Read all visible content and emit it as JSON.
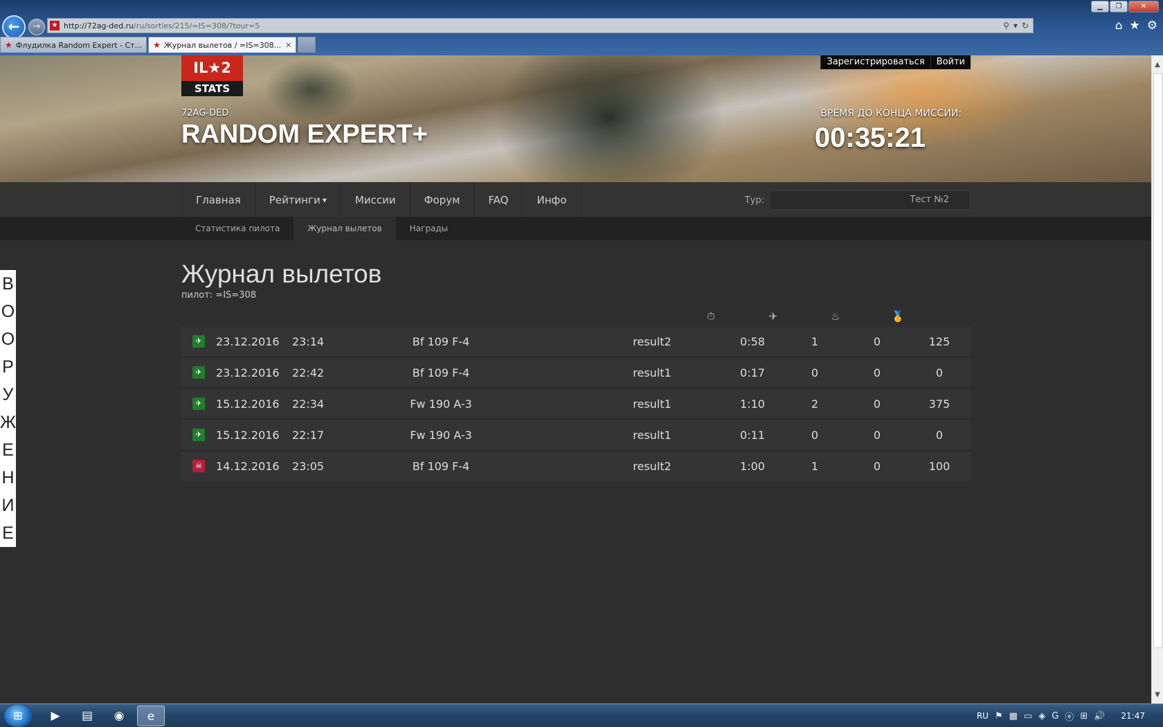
{
  "browser": {
    "url_host": "http://72ag-ded.ru",
    "url_path": "/ru/sorties/215/=IS=308/?tour=5",
    "tabs": [
      {
        "label": "Флудилка Random Expert - Ст..."
      },
      {
        "label": "Журнал вылетов / =IS=308..."
      }
    ],
    "window_controls": {
      "minimize": "▁",
      "restore": "❐",
      "close": "✕"
    }
  },
  "header": {
    "logo_top": "IL★2",
    "logo_bottom": "STATS",
    "server_name": "72AG-DED",
    "site_title": "RANDOM EXPERT+",
    "register": "Зарегистрироваться",
    "login": "Войти",
    "timer_label": "ВРЕМЯ ДО КОНЦА МИССИИ:",
    "timer_value": "00:35:21"
  },
  "nav": {
    "items": [
      "Главная",
      "Рейтинги",
      "Миссии",
      "Форум",
      "FAQ",
      "Инфо"
    ],
    "tour_label": "Тур:",
    "tour_value": "Тест №2"
  },
  "subnav": {
    "items": [
      "Статистика пилота",
      "Журнал вылетов",
      "Награды"
    ],
    "active": "Журнал вылетов"
  },
  "side_widget": {
    "letters": [
      "В",
      "О",
      "О",
      "Р",
      "У",
      "Ж",
      "Е",
      "Н",
      "И",
      "Е"
    ]
  },
  "content": {
    "title": "Журнал вылетов",
    "pilot_line": "пилот: =IS=308",
    "column_icons": [
      "stopwatch-icon",
      "plane-icon",
      "fire-icon",
      "medal-icon"
    ],
    "rows": [
      {
        "status": "landed",
        "date": "23.12.2016",
        "time": "23:14",
        "aircraft": "Bf 109 F-4",
        "result": "result2",
        "flight_time": "0:58",
        "air_kills": "1",
        "ground_kills": "0",
        "score": "125"
      },
      {
        "status": "landed",
        "date": "23.12.2016",
        "time": "22:42",
        "aircraft": "Bf 109 F-4",
        "result": "result1",
        "flight_time": "0:17",
        "air_kills": "0",
        "ground_kills": "0",
        "score": "0"
      },
      {
        "status": "landed",
        "date": "15.12.2016",
        "time": "22:34",
        "aircraft": "Fw 190 A-3",
        "result": "result1",
        "flight_time": "1:10",
        "air_kills": "2",
        "ground_kills": "0",
        "score": "375"
      },
      {
        "status": "landed",
        "date": "15.12.2016",
        "time": "22:17",
        "aircraft": "Fw 190 A-3",
        "result": "result1",
        "flight_time": "0:11",
        "air_kills": "0",
        "ground_kills": "0",
        "score": "0"
      },
      {
        "status": "killed",
        "date": "14.12.2016",
        "time": "23:05",
        "aircraft": "Bf 109 F-4",
        "result": "result2",
        "flight_time": "1:00",
        "air_kills": "1",
        "ground_kills": "0",
        "score": "100"
      }
    ]
  },
  "taskbar": {
    "language": "RU",
    "clock": "21:47"
  },
  "colors": {
    "logo_red": "#c9261c",
    "landed_green": "#1f7d2b",
    "killed_red": "#b4203a",
    "page_bg": "#2e2e2e"
  }
}
